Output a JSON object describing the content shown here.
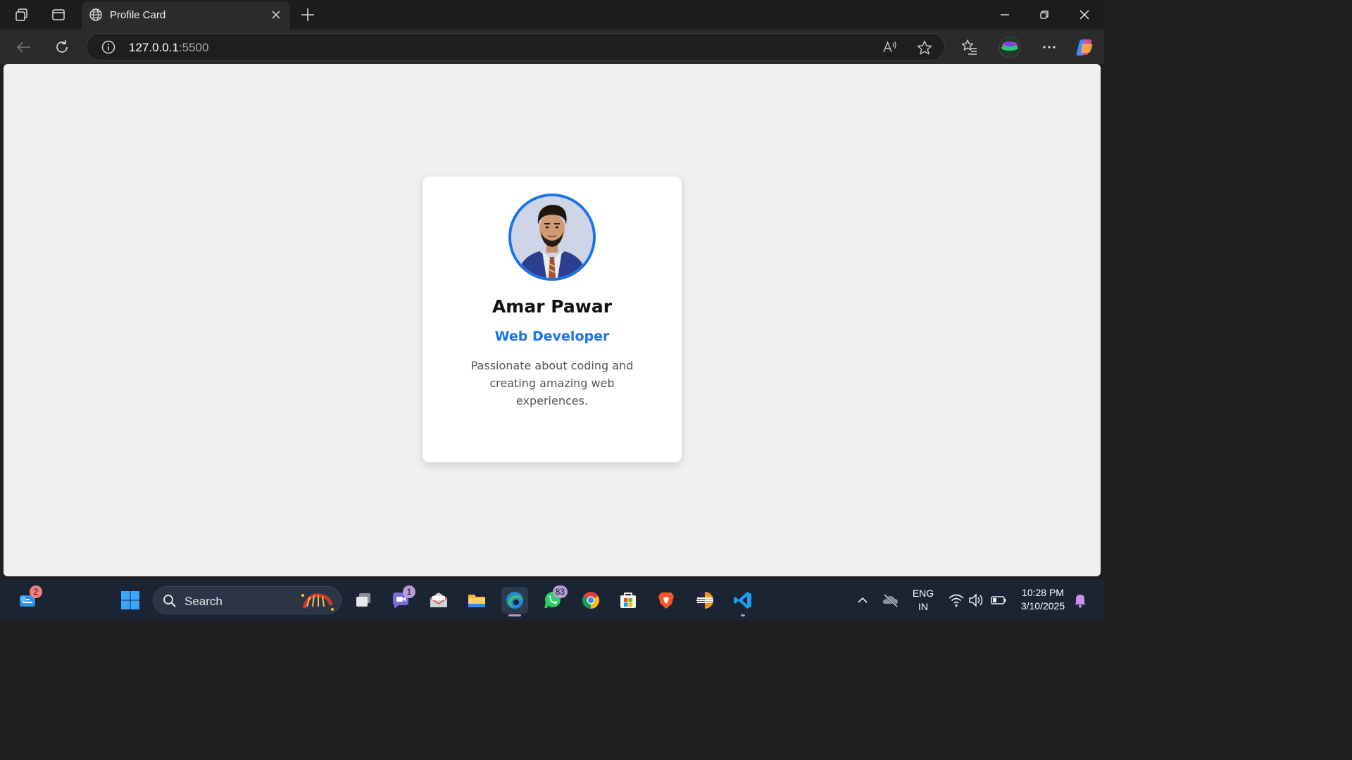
{
  "browser": {
    "tab_title": "Profile Card",
    "url_host": "127.0.0.1",
    "url_port": ":5500"
  },
  "card": {
    "name": "Amar Pawar",
    "role": "Web Developer",
    "bio": "Passionate about coding and creating amazing web experiences.",
    "accent_color": "#1a73e8"
  },
  "taskbar": {
    "search_label": "Search",
    "badges": {
      "widgets": "2",
      "teams": "1",
      "whatsapp": "83"
    },
    "language": "ENG",
    "region": "IN",
    "time": "10:28 PM",
    "date": "3/10/2025"
  }
}
